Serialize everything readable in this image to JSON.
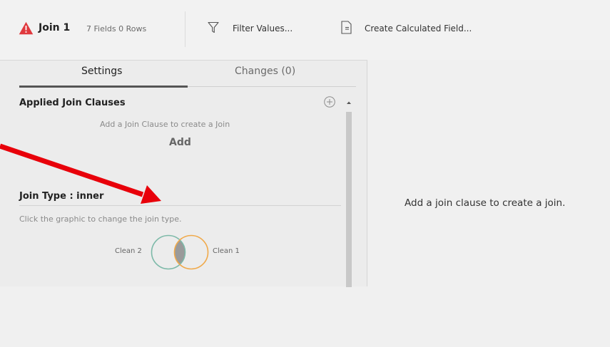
{
  "toolbar": {
    "step_title": "Join 1",
    "step_meta": "7 Fields 0 Rows",
    "filter_label": "Filter Values...",
    "calc_label": "Create Calculated Field..."
  },
  "tabs": [
    {
      "label": "Settings",
      "active": true
    },
    {
      "label": "Changes (0)",
      "active": false
    }
  ],
  "applied_join_clauses": {
    "title": "Applied Join Clauses",
    "hint": "Add a Join Clause to create a Join",
    "add_label": "Add"
  },
  "join_type": {
    "title": "Join Type : inner",
    "hint": "Click the graphic to change the join type.",
    "left_input": "Clean 2",
    "right_input": "Clean 1"
  },
  "right_panel": {
    "message": "Add a join clause to create a join."
  },
  "icons": {
    "warning": "warning-triangle-icon",
    "filter": "filter-funnel-icon",
    "calculated_field": "calculated-field-icon",
    "add_clause": "plus-circle-icon",
    "scroll_up": "scroll-up-icon"
  },
  "colors": {
    "warning": "#e0393e",
    "venn_left": "#7cb9a8",
    "venn_right": "#f0a94a",
    "venn_overlap": "#9a9a9a",
    "annotation_arrow": "#e8000a"
  }
}
